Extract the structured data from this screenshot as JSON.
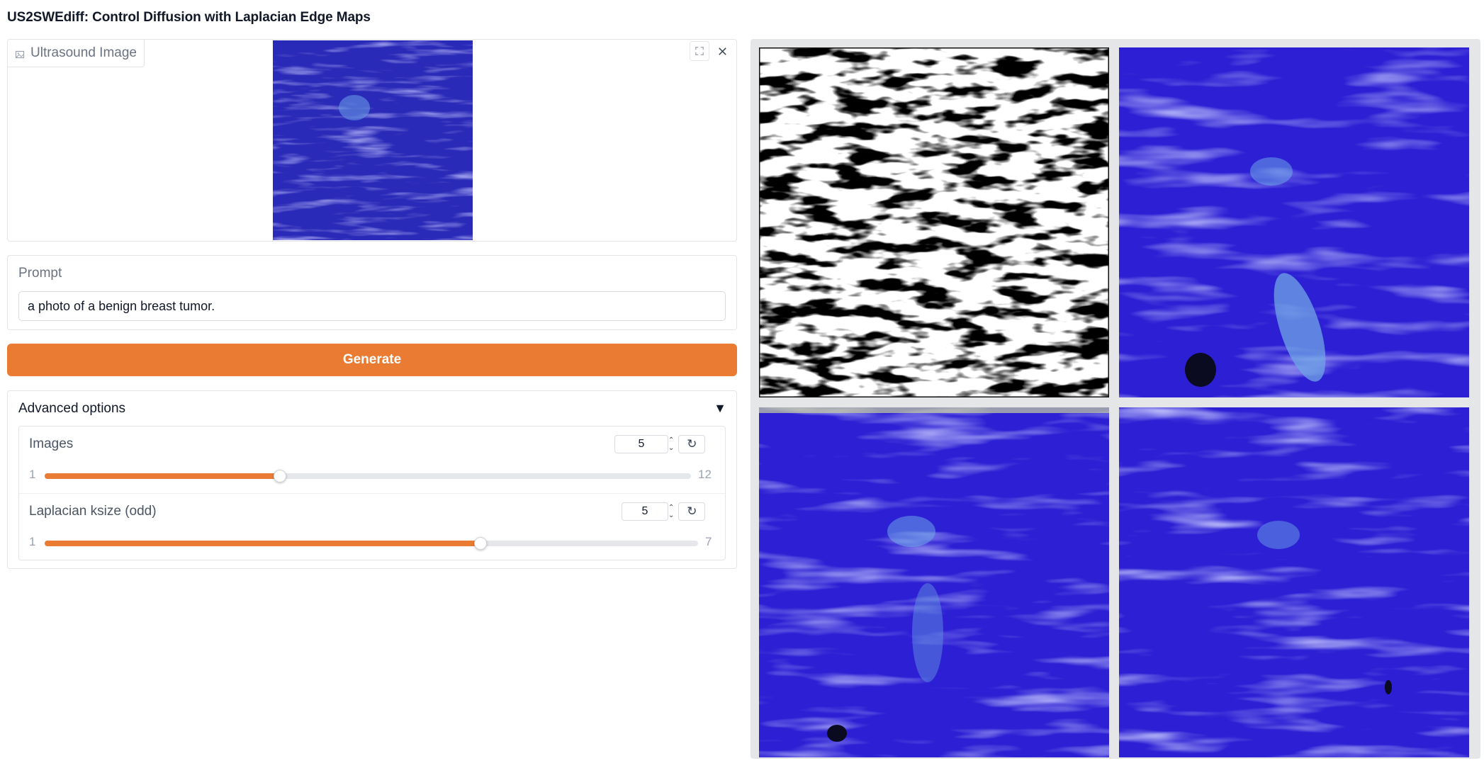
{
  "app": {
    "title": "US2SWEdiff: Control Diffusion with Laplacian Edge Maps"
  },
  "image_input": {
    "label": "Ultrasound Image",
    "icons": [
      "image-icon",
      "fullscreen-icon",
      "close-icon"
    ]
  },
  "prompt": {
    "label": "Prompt",
    "value": "a photo of a benign breast tumor."
  },
  "generate": {
    "label": "Generate"
  },
  "advanced": {
    "label": "Advanced options",
    "toggle": "▼",
    "images": {
      "label": "Images",
      "value": "5",
      "min": "1",
      "max": "12",
      "fraction": 0.3636
    },
    "ksize": {
      "label": "Laplacian ksize (odd)",
      "value": "5",
      "min": "1",
      "max": "7",
      "fraction": 0.6667
    }
  },
  "gallery": {
    "tiles": [
      "edge-map",
      "generated-1",
      "generated-2",
      "generated-3"
    ]
  },
  "colors": {
    "accent": "#ea7b33",
    "ultrasound_blue": "#2f1fd6"
  }
}
